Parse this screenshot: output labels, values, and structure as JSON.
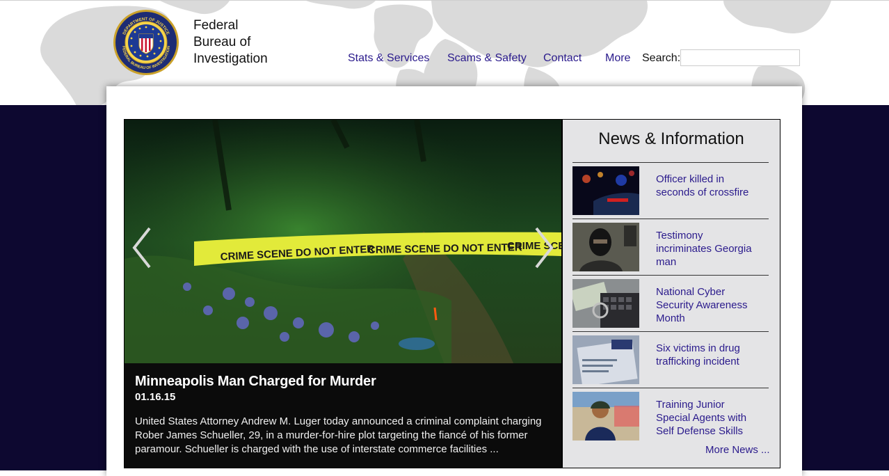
{
  "site": {
    "title_lines": [
      "Federal",
      "Bureau of",
      "Investigation"
    ],
    "seal_outer_text": "DEPARTMENT OF JUSTICE",
    "seal_inner_text": "FEDERAL BUREAU OF INVESTIGATION"
  },
  "nav": {
    "items": [
      {
        "label": "Stats & Services"
      },
      {
        "label": "Scams & Safety"
      },
      {
        "label": "Contact"
      },
      {
        "label": "More"
      }
    ],
    "search_label": "Search:",
    "search_value": ""
  },
  "slider": {
    "tape_text": "CRIME SCENE DO NOT ENTER",
    "title": "Minneapolis Man Charged for Murder",
    "date": "01.16.15",
    "description": "United States Attorney Andrew M. Luger today announced a criminal complaint charging Rober James Schueller, 29, in a murder-for-hire plot targeting the fiancé of his former paramour. Schueller is charged with the use of interstate commerce facilities ...",
    "prev_icon": "chevron-left-icon",
    "next_icon": "chevron-right-icon"
  },
  "news": {
    "heading": "News & Information",
    "items": [
      {
        "title": "Officer killed in seconds of crossfire"
      },
      {
        "title": "Testimony incriminates Georgia man"
      },
      {
        "title": "National Cyber Security Awareness Month"
      },
      {
        "title": "Six victims in drug trafficking incident"
      },
      {
        "title": "Training Junior Special Agents with Self Defense Skills"
      }
    ],
    "more_label": "More News ..."
  },
  "colors": {
    "link": "#2a1a8c",
    "navy_band": "#0d0830",
    "news_bg": "#e4e4e6"
  }
}
